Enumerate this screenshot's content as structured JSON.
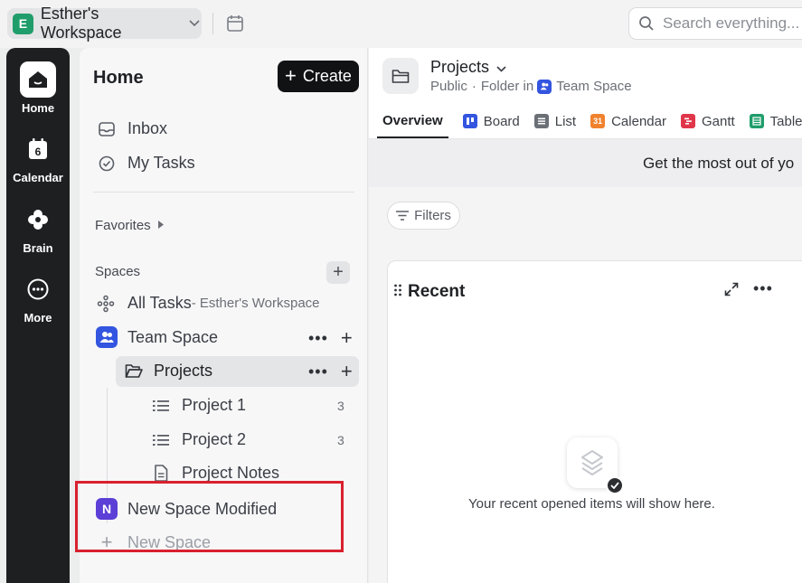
{
  "workspace": {
    "badge": "E",
    "name": "Esther's Workspace",
    "badge_color": "#1f9d6b"
  },
  "search": {
    "placeholder": "Search everything..."
  },
  "rail": [
    {
      "label": "Home",
      "icon": "home-icon"
    },
    {
      "label": "Calendar",
      "icon": "calendar-icon",
      "day": "6"
    },
    {
      "label": "Brain",
      "icon": "brain-icon"
    },
    {
      "label": "More",
      "icon": "more-icon"
    }
  ],
  "sidebar": {
    "title": "Home",
    "create_label": "Create",
    "inbox": "Inbox",
    "my_tasks": "My Tasks",
    "favorites": "Favorites",
    "spaces": "Spaces",
    "all_tasks": "All Tasks",
    "all_tasks_suffix": " - Esther's Workspace",
    "team_space": "Team Space",
    "projects": "Projects",
    "children": [
      {
        "label": "Project 1",
        "count": "3"
      },
      {
        "label": "Project 2",
        "count": "3"
      },
      {
        "label": "Project Notes"
      }
    ],
    "new_space_modified": {
      "badge": "N",
      "label": "New Space Modified",
      "color": "#5b3fd6"
    },
    "new_space": "New Space"
  },
  "main": {
    "folder_title": "Projects",
    "visibility": "Public",
    "folder_in": "Folder in",
    "parent_space": "Team Space",
    "tabs": [
      {
        "label": "Overview",
        "active": true
      },
      {
        "label": "Board",
        "icon": "board-icon",
        "color": "#3355e0"
      },
      {
        "label": "List",
        "icon": "list-icon",
        "color": "#6b6f76"
      },
      {
        "label": "Calendar",
        "icon": "calendar-icon",
        "color": "#f0822e",
        "day": "31"
      },
      {
        "label": "Gantt",
        "icon": "gantt-icon",
        "color": "#e0364a"
      },
      {
        "label": "Table",
        "icon": "table-icon",
        "color": "#1f9d6b"
      }
    ],
    "banner": "Get the most out of yo",
    "filters_label": "Filters",
    "recent": {
      "title": "Recent",
      "empty_text": "Your recent opened items will show here."
    }
  }
}
